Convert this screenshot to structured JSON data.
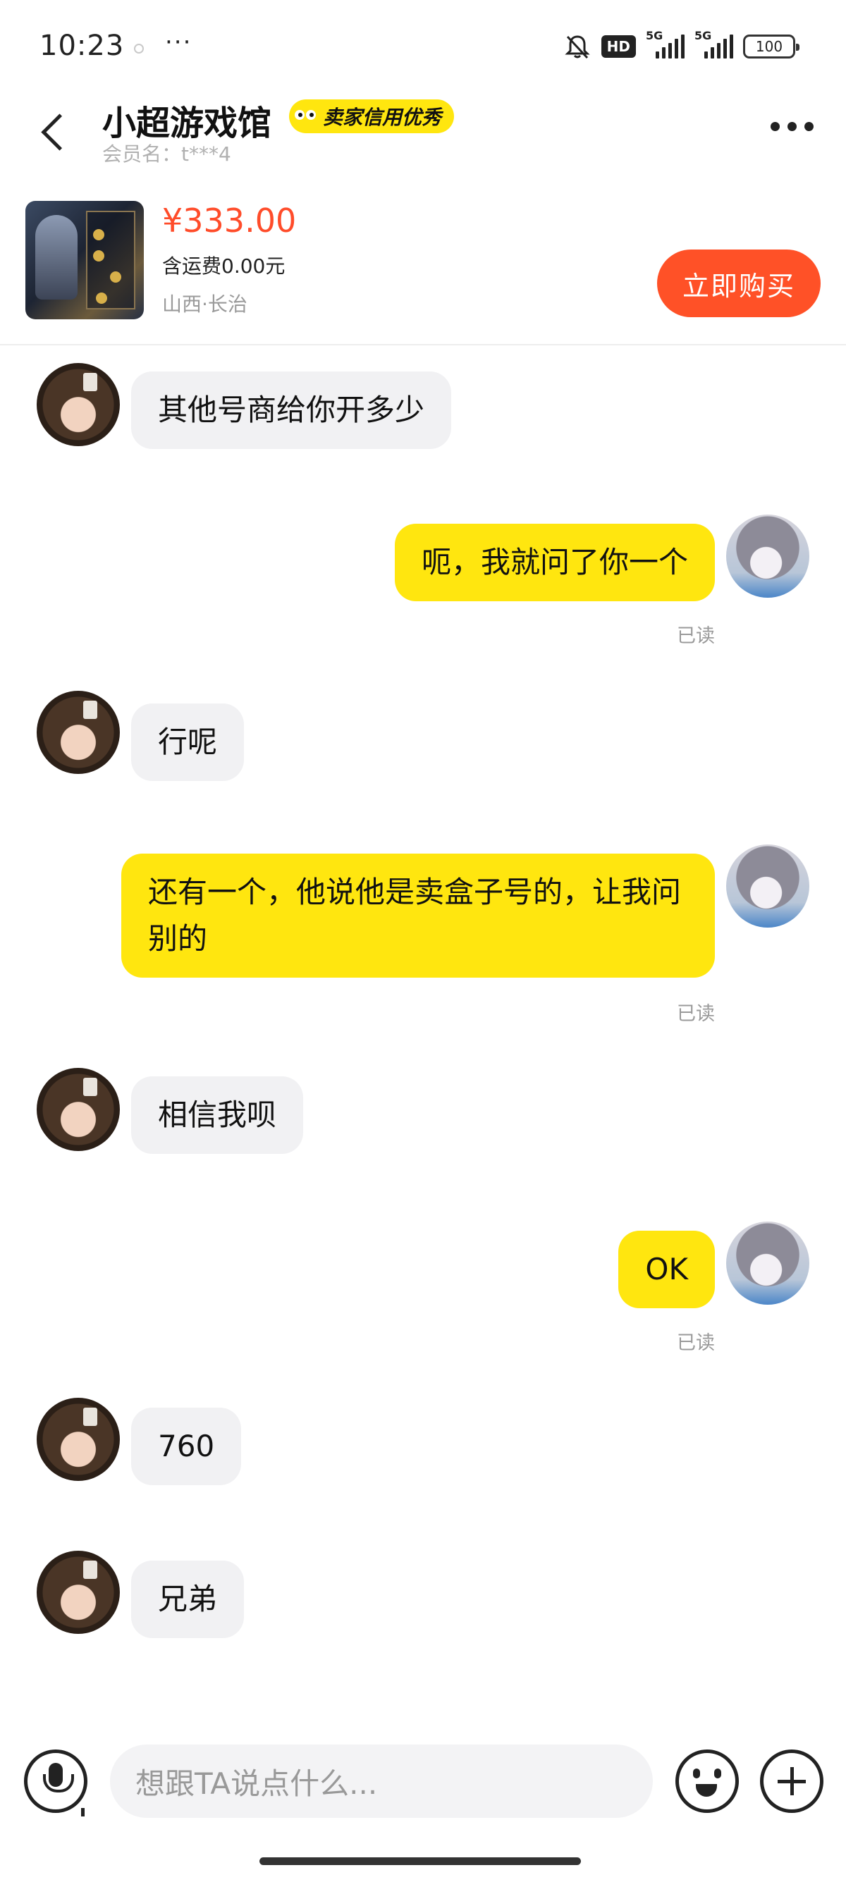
{
  "status_bar": {
    "time": "10:23",
    "more": "···",
    "hd": "HD",
    "signal_1": "5G",
    "signal_2": "5G",
    "battery": "100"
  },
  "header": {
    "shop_name": "小超游戏馆",
    "credit_badge": "卖家信用优秀",
    "member_name": "会员名：t***4",
    "icons": {
      "back": "chevron-left-icon",
      "more": "more-dots-icon"
    }
  },
  "product": {
    "price": "¥333.00",
    "shipping": "含运费0.00元",
    "location": "山西·长治",
    "buy_button": "立即购买",
    "colors": {
      "price": "#ff4c2a",
      "buy_button": "#ff5127"
    }
  },
  "messages": [
    {
      "side": "left",
      "text": "其他号商给你开多少"
    },
    {
      "side": "right",
      "text": "呃，我就问了你一个",
      "status": "已读"
    },
    {
      "side": "left",
      "text": "行呢"
    },
    {
      "side": "right",
      "text": "还有一个，他说他是卖盒子号的，让我问别的",
      "status": "已读"
    },
    {
      "side": "left",
      "text": "相信我呗"
    },
    {
      "side": "right",
      "text": "OK",
      "status": "已读"
    },
    {
      "side": "left",
      "text": "760"
    },
    {
      "side": "left",
      "text": "兄弟"
    }
  ],
  "input_bar": {
    "placeholder": "想跟TA说点什么...",
    "icons": {
      "voice": "microphone-icon",
      "emoji": "emoji-icon",
      "add": "plus-icon"
    }
  },
  "colors": {
    "own_bubble": "#ffe60f",
    "other_bubble": "#f1f1f3",
    "credit_badge": "#ffe60f"
  }
}
